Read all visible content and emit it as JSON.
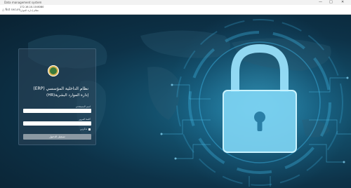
{
  "browser": {
    "window_title": "Data management system",
    "secure_text": "Not secure",
    "address": "172.16.10.10:8080",
    "address_sub": "نظام إدارة الموارد",
    "controls": {
      "minimize": "—",
      "maximize": "□",
      "close": "✕"
    }
  },
  "login": {
    "title": "نظام الداخلية المؤسسي (ERP)",
    "subtitle": "إدارة الموارد البشرية(HR)",
    "username_label": "اسم المستخدم",
    "username_value": "",
    "password_label": "كلمة المرور",
    "password_value": "",
    "remember_label": "تذكرني",
    "submit_label": "تسجيل الدخول"
  },
  "colors": {
    "background_dark": "#0c2333",
    "glow": "#3fb6e6",
    "button": "#8c99a3",
    "logo_gold": "#d9b451"
  },
  "icons": [
    "lock-icon",
    "logo-emblem",
    "shield-warning-icon"
  ]
}
